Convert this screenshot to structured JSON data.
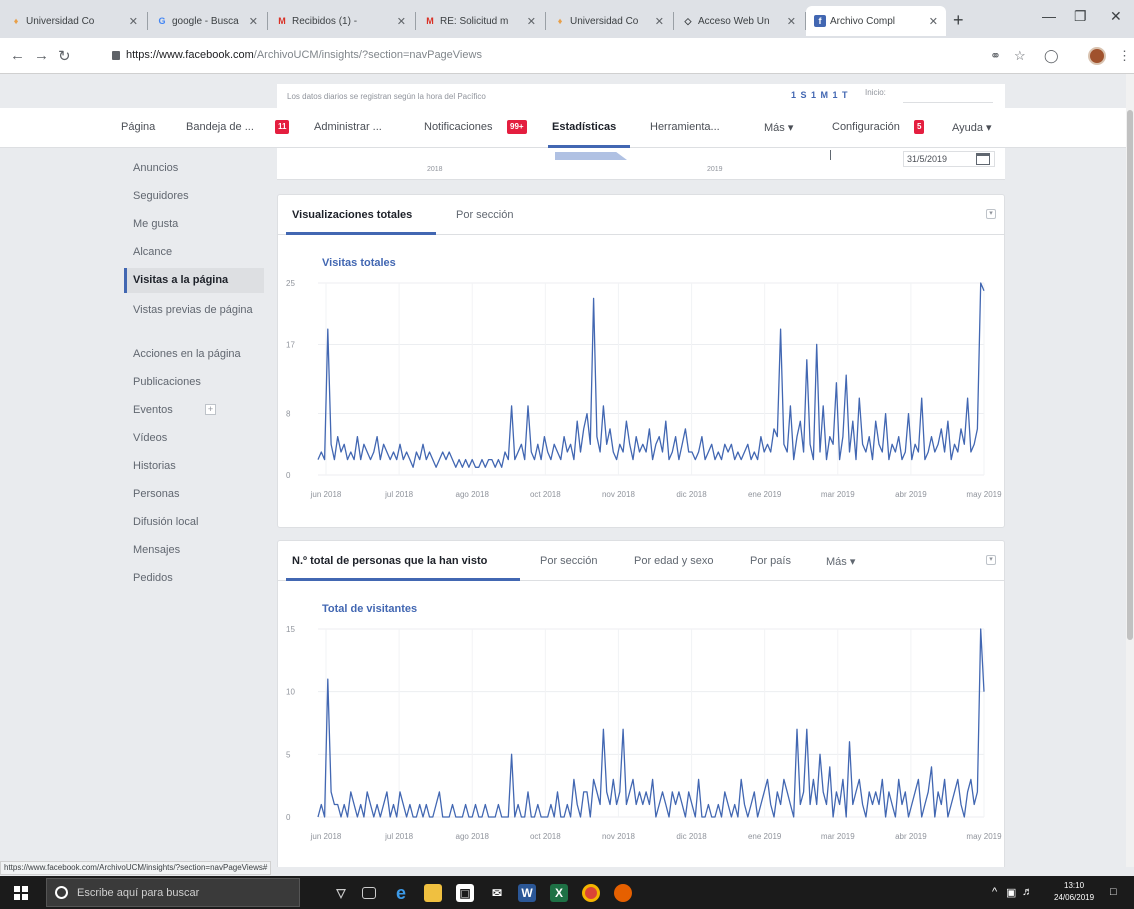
{
  "browser": {
    "tabs": [
      {
        "title": "Universidad Co",
        "favicon_color": "#e8a04a",
        "favicon_glyph": "♦"
      },
      {
        "title": "google - Busca",
        "favicon_color": "#4285f4",
        "favicon_glyph": "G"
      },
      {
        "title": "Recibidos (1) - ",
        "favicon_color": "#d93025",
        "favicon_glyph": "M"
      },
      {
        "title": "RE: Solicitud m",
        "favicon_color": "#d93025",
        "favicon_glyph": "M"
      },
      {
        "title": "Universidad Co",
        "favicon_color": "#e8a04a",
        "favicon_glyph": "♦"
      },
      {
        "title": "Acceso Web Un",
        "favicon_color": "#3c4043",
        "favicon_glyph": "◇"
      },
      {
        "title": "Archivo Compl",
        "favicon_color": "#4267b2",
        "favicon_glyph": "f"
      }
    ],
    "url_host": "https://www.facebook.com",
    "url_path": "/ArchivoUCM/insights/?section=navPageViews",
    "status_url": "https://www.facebook.com/ArchivoUCM/insights/?section=navPageViews#"
  },
  "page": {
    "daily_note": "Los datos diarios se registran según la hora del Pacífico",
    "ranges": "1 S  1 M  1 T",
    "start_label": "Inicio:",
    "end_date": "31/5/2019",
    "timeline_years": [
      "2018",
      "2019"
    ]
  },
  "topnav": {
    "items": [
      {
        "label": "Página"
      },
      {
        "label": "Bandeja de ..."
      },
      {
        "label": "Administrar ..."
      },
      {
        "label": "Notificaciones"
      },
      {
        "label": "Estadísticas"
      },
      {
        "label": "Herramienta..."
      },
      {
        "label": "Más ▾"
      },
      {
        "label": "Configuración"
      },
      {
        "label": "Ayuda ▾"
      }
    ],
    "badges": {
      "inbox": "11",
      "notifications": "99+",
      "settings": "5"
    }
  },
  "sidebar": {
    "items": [
      {
        "label": "Anuncios"
      },
      {
        "label": "Seguidores"
      },
      {
        "label": "Me gusta"
      },
      {
        "label": "Alcance"
      },
      {
        "label": "Visitas a la página"
      },
      {
        "label": "Vistas previas de página"
      },
      {
        "label": "Acciones en la página"
      },
      {
        "label": "Publicaciones"
      },
      {
        "label": "Eventos"
      },
      {
        "label": "Vídeos"
      },
      {
        "label": "Historias"
      },
      {
        "label": "Personas"
      },
      {
        "label": "Difusión local"
      },
      {
        "label": "Mensajes"
      },
      {
        "label": "Pedidos"
      }
    ]
  },
  "card1": {
    "tabs": [
      "Visualizaciones totales",
      "Por sección"
    ],
    "chart_title": "Visitas totales"
  },
  "card2": {
    "tabs": [
      "N.º total de personas que la han visto",
      "Por sección",
      "Por edad y sexo",
      "Por país",
      "Más ▾"
    ],
    "chart_title": "Total de visitantes"
  },
  "taskbar": {
    "search_placeholder": "Escribe aquí para buscar",
    "time": "13:10",
    "date": "24/06/2019"
  },
  "chart_data": [
    {
      "type": "line",
      "title": "Visitas totales",
      "xlabel": "",
      "ylabel": "",
      "x_ticks": [
        "jun 2018",
        "jul 2018",
        "ago 2018",
        "oct 2018",
        "nov 2018",
        "dic 2018",
        "ene 2019",
        "mar 2019",
        "abr 2019",
        "may 2019"
      ],
      "y_ticks": [
        0,
        8,
        17,
        25
      ],
      "ylim": [
        0,
        25
      ],
      "grid": true,
      "color": "#4267b2",
      "series": [
        {
          "values": [
            2,
            3,
            2,
            19,
            4,
            2,
            5,
            3,
            4,
            2,
            3,
            2,
            5,
            2,
            4,
            3,
            2,
            3,
            5,
            2,
            4,
            3,
            2,
            3,
            2,
            4,
            2,
            3,
            2,
            1,
            3,
            2,
            4,
            2,
            3,
            2,
            1,
            2,
            3,
            2,
            3,
            2,
            1,
            2,
            1,
            2,
            1,
            2,
            1,
            1,
            2,
            1,
            2,
            2,
            1,
            2,
            1,
            3,
            2,
            9,
            2,
            3,
            4,
            2,
            9,
            3,
            2,
            4,
            2,
            5,
            3,
            2,
            4,
            3,
            2,
            5,
            3,
            4,
            2,
            7,
            3,
            6,
            8,
            4,
            23,
            5,
            3,
            9,
            4,
            6,
            3,
            2,
            4,
            3,
            7,
            4,
            2,
            5,
            3,
            4,
            3,
            6,
            2,
            4,
            5,
            3,
            7,
            2,
            3,
            5,
            2,
            4,
            6,
            3,
            3,
            2,
            3,
            5,
            2,
            3,
            4,
            2,
            3,
            2,
            4,
            3,
            4,
            2,
            3,
            2,
            3,
            4,
            2,
            3,
            2,
            5,
            3,
            4,
            3,
            6,
            5,
            19,
            4,
            3,
            9,
            2,
            5,
            7,
            3,
            15,
            4,
            2,
            17,
            3,
            9,
            2,
            5,
            4,
            12,
            2,
            5,
            13,
            3,
            7,
            2,
            10,
            4,
            3,
            5,
            2,
            7,
            4,
            3,
            8,
            2,
            4,
            3,
            5,
            2,
            3,
            8,
            2,
            4,
            3,
            10,
            2,
            3,
            5,
            3,
            4,
            6,
            3,
            7,
            2,
            4,
            3,
            6,
            4,
            10,
            3,
            4,
            6,
            25,
            24
          ]
        }
      ]
    },
    {
      "type": "line",
      "title": "Total de visitantes",
      "xlabel": "",
      "ylabel": "",
      "x_ticks": [
        "jun 2018",
        "jul 2018",
        "ago 2018",
        "oct 2018",
        "nov 2018",
        "dic 2018",
        "ene 2019",
        "mar 2019",
        "abr 2019",
        "may 2019"
      ],
      "y_ticks": [
        0,
        5,
        10,
        15
      ],
      "ylim": [
        0,
        15
      ],
      "grid": true,
      "color": "#4267b2",
      "series": [
        {
          "values": [
            0,
            1,
            0,
            11,
            2,
            1,
            1,
            0,
            1,
            0,
            2,
            1,
            0,
            1,
            0,
            2,
            1,
            0,
            1,
            0,
            1,
            2,
            0,
            1,
            0,
            2,
            1,
            0,
            1,
            0,
            0,
            1,
            0,
            1,
            0,
            0,
            1,
            2,
            0,
            0,
            0,
            1,
            0,
            0,
            0,
            1,
            0,
            0,
            1,
            0,
            0,
            1,
            0,
            0,
            0,
            1,
            0,
            0,
            0,
            5,
            0,
            1,
            0,
            0,
            2,
            0,
            0,
            1,
            0,
            0,
            0,
            1,
            0,
            2,
            0,
            0,
            1,
            0,
            3,
            1,
            0,
            2,
            2,
            0,
            3,
            2,
            1,
            7,
            2,
            1,
            3,
            1,
            2,
            7,
            1,
            2,
            3,
            1,
            2,
            1,
            2,
            1,
            3,
            0,
            1,
            2,
            1,
            0,
            2,
            1,
            2,
            1,
            0,
            2,
            1,
            0,
            3,
            0,
            0,
            1,
            0,
            0,
            1,
            0,
            2,
            1,
            0,
            1,
            0,
            3,
            1,
            0,
            1,
            2,
            0,
            1,
            2,
            3,
            1,
            0,
            2,
            1,
            3,
            2,
            1,
            0,
            7,
            1,
            2,
            7,
            1,
            3,
            1,
            5,
            2,
            1,
            4,
            0,
            2,
            1,
            3,
            0,
            6,
            1,
            2,
            3,
            1,
            0,
            2,
            1,
            2,
            1,
            3,
            0,
            2,
            1,
            0,
            3,
            1,
            2,
            0,
            1,
            2,
            3,
            0,
            1,
            2,
            4,
            0,
            2,
            1,
            3,
            0,
            1,
            2,
            3,
            1,
            0,
            2,
            3,
            1,
            2,
            15,
            10
          ]
        }
      ]
    }
  ]
}
